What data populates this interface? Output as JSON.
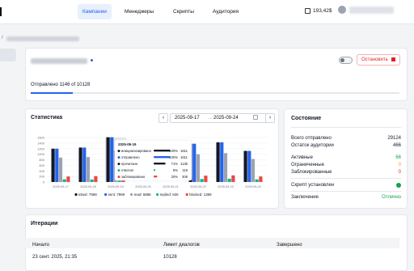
{
  "nav": {
    "campaigns": "Кампании",
    "managers": "Менеджеры",
    "scripts": "Скрипты",
    "audience": "Аудитория"
  },
  "balance": "193,42$",
  "campaign": {
    "breadcrumb_sep": "/",
    "stop_label": "Остановить",
    "sent_text": "Отправлено 1146 of 10128",
    "progress_fraction": 0.113
  },
  "stats": {
    "title": "Статистика",
    "date_from": "2025-09-17",
    "date_sep": "→",
    "date_to": "2025-09-24",
    "prev": "‹",
    "next": "›"
  },
  "chart_data": {
    "type": "bar",
    "categories": [
      "2025-09-17",
      "2025-09-18",
      "2025-09-19",
      "2025-09-20",
      "2025-09-21",
      "2025-09-22",
      "2025-09-23",
      "2025-09-24"
    ],
    "ylim": [
      0,
      1600
    ],
    "yticks": [
      "0",
      "200",
      "400",
      "600",
      "800",
      "1000",
      "1200",
      "1400",
      "1600"
    ],
    "series": [
      {
        "name": "inited: 7969",
        "color": "#111827",
        "values": [
          1200,
          1240,
          1611,
          0,
          0,
          1380,
          1430,
          1120
        ]
      },
      {
        "name": "sent: 7969",
        "color": "#2563eb",
        "values": [
          1200,
          1240,
          1611,
          0,
          0,
          1380,
          1430,
          1120
        ]
      },
      {
        "name": "read: 5886",
        "color": "#9ca3af",
        "values": [
          880,
          900,
          1135,
          0,
          0,
          1000,
          1040,
          830
        ]
      },
      {
        "name": "replied: 635",
        "color": "#10b981",
        "values": [
          100,
          90,
          119,
          0,
          0,
          110,
          120,
          96
        ]
      },
      {
        "name": "blocked: 1389",
        "color": "#ef4444",
        "values": [
          200,
          210,
          308,
          0,
          0,
          230,
          240,
          201
        ]
      }
    ],
    "tooltip": {
      "date": "2025-09-19",
      "rows": [
        {
          "label": "инициализировано",
          "pct": "100%",
          "val": "1611",
          "color": "#111827",
          "frac": 1.0
        },
        {
          "label": "отправлено",
          "pct": "100%",
          "val": "1611",
          "color": "#2563eb",
          "frac": 1.0
        },
        {
          "label": "прочитано",
          "pct": "71%",
          "val": "1135",
          "color": "#111827",
          "frac": 0.71
        },
        {
          "label": "ответил",
          "pct": "8%",
          "val": "119",
          "color": "#10b981",
          "frac": 0.08
        },
        {
          "label": "заблокировано",
          "pct": "20%",
          "val": "308",
          "color": "#ef4444",
          "frac": 0.2
        }
      ]
    }
  },
  "state": {
    "title": "Состояние",
    "rows": [
      {
        "label": "Всего отправлено",
        "value": "29124",
        "color": "#111827"
      },
      {
        "label": "Остаток аудитории",
        "value": "466",
        "color": "#111827"
      },
      {
        "label": "Активные",
        "value": "66",
        "color": "#16a34a"
      },
      {
        "label": "Ограниченные",
        "value": "0",
        "color": "#f59e0b"
      },
      {
        "label": "Заблокированные",
        "value": "0",
        "color": "#dc2626"
      }
    ],
    "script_label": "Скрипт установлен",
    "conclusion_label": "Заключение",
    "conclusion_value": "Отлично",
    "conclusion_color": "#16a34a"
  },
  "iterations": {
    "title": "Итерации",
    "columns": [
      "Начало",
      "Лимит диалогов",
      "Завершено"
    ],
    "rows": [
      [
        "23 сент. 2025, 21:35",
        "10128",
        ""
      ]
    ]
  }
}
